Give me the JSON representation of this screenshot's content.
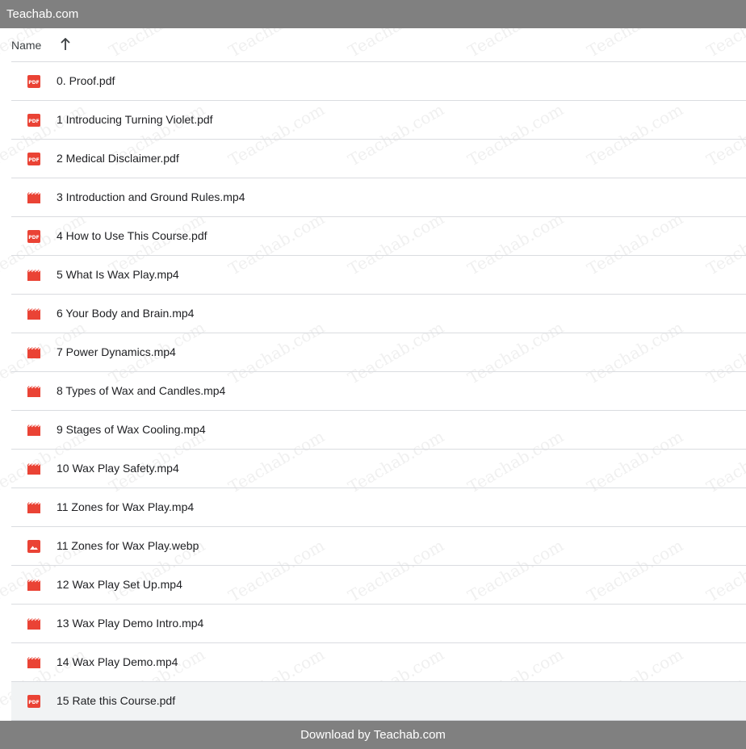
{
  "top_bar": {
    "title": "Teachab.com"
  },
  "list_header": {
    "name_label": "Name",
    "sort_icon": "arrow-up-icon"
  },
  "files": [
    {
      "name": "0. Proof.pdf",
      "type": "pdf",
      "icon": "pdf-icon"
    },
    {
      "name": "1 Introducing Turning Violet.pdf",
      "type": "pdf",
      "icon": "pdf-icon"
    },
    {
      "name": "2 Medical Disclaimer.pdf",
      "type": "pdf",
      "icon": "pdf-icon"
    },
    {
      "name": "3 Introduction and Ground Rules.mp4",
      "type": "video",
      "icon": "video-icon"
    },
    {
      "name": "4 How to Use This Course.pdf",
      "type": "pdf",
      "icon": "pdf-icon"
    },
    {
      "name": "5 What Is Wax Play.mp4",
      "type": "video",
      "icon": "video-icon"
    },
    {
      "name": "6 Your Body and Brain.mp4",
      "type": "video",
      "icon": "video-icon"
    },
    {
      "name": "7 Power Dynamics.mp4",
      "type": "video",
      "icon": "video-icon"
    },
    {
      "name": "8 Types of Wax and Candles.mp4",
      "type": "video",
      "icon": "video-icon"
    },
    {
      "name": "9 Stages of Wax Cooling.mp4",
      "type": "video",
      "icon": "video-icon"
    },
    {
      "name": "10 Wax Play Safety.mp4",
      "type": "video",
      "icon": "video-icon"
    },
    {
      "name": "11 Zones for Wax Play.mp4",
      "type": "video",
      "icon": "video-icon"
    },
    {
      "name": "11 Zones for Wax Play.webp",
      "type": "image",
      "icon": "image-icon"
    },
    {
      "name": "12 Wax Play Set Up.mp4",
      "type": "video",
      "icon": "video-icon"
    },
    {
      "name": "13 Wax Play Demo Intro.mp4",
      "type": "video",
      "icon": "video-icon"
    },
    {
      "name": "14 Wax Play Demo.mp4",
      "type": "video",
      "icon": "video-icon"
    },
    {
      "name": "15 Rate this Course.pdf",
      "type": "pdf",
      "icon": "pdf-icon",
      "selected": true
    }
  ],
  "footer": {
    "text": "Download by Teachab.com"
  },
  "watermark": {
    "text": "Teachab.com"
  },
  "colors": {
    "bar": "#808080",
    "file_icon": "#ea4335",
    "divider": "#dadce0",
    "selected_row": "#f1f3f4"
  }
}
